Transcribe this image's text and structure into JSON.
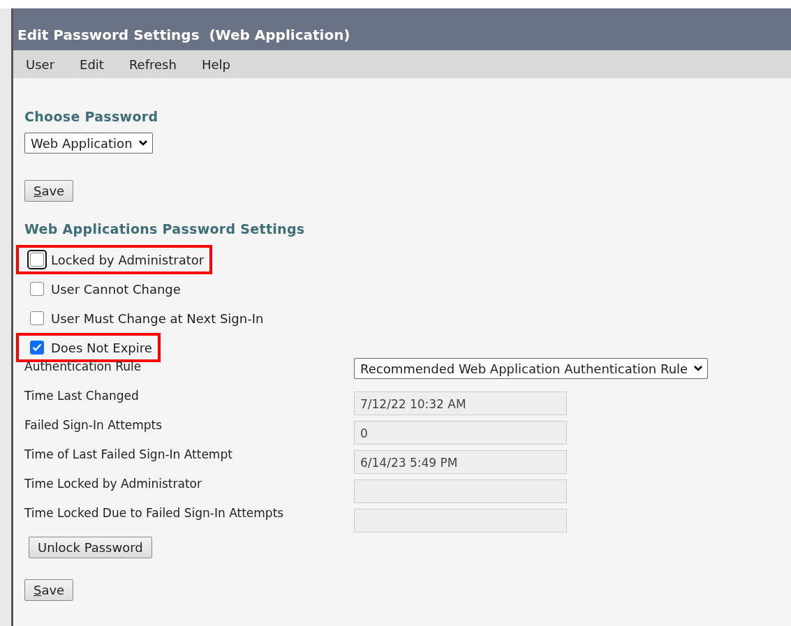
{
  "window": {
    "title": "Edit Password Settings  (Web Application)"
  },
  "menu": [
    "User",
    "Edit",
    "Refresh",
    "Help"
  ],
  "choose_password": {
    "heading": "Choose Password",
    "value": "Web Application",
    "save": "Save"
  },
  "settings": {
    "heading": "Web Applications Password Settings",
    "checkboxes": [
      {
        "label": "Locked by Administrator",
        "checked": false,
        "highlighted": true,
        "focused": true
      },
      {
        "label": "User Cannot Change",
        "checked": false,
        "highlighted": false
      },
      {
        "label": "User Must Change at Next Sign-In",
        "checked": false,
        "highlighted": false
      },
      {
        "label": "Does Not Expire",
        "checked": true,
        "highlighted": true
      }
    ],
    "fields": [
      {
        "kind": "select",
        "label": "Authentication Rule",
        "value": "Recommended Web Application Authentication Rule"
      },
      {
        "kind": "readonly",
        "label": "Time Last Changed",
        "value": "7/12/22 10:32 AM"
      },
      {
        "kind": "readonly",
        "label": "Failed Sign-In Attempts",
        "value": "0"
      },
      {
        "kind": "readonly",
        "label": "Time of Last Failed Sign-In Attempt",
        "value": "6/14/23 5:49 PM"
      },
      {
        "kind": "readonly",
        "label": "Time Locked by Administrator"
      },
      {
        "kind": "readonly",
        "label": "Time Locked Due to Failed Sign-In Attempts"
      }
    ],
    "unlock": "Unlock Password",
    "save": "Save"
  }
}
